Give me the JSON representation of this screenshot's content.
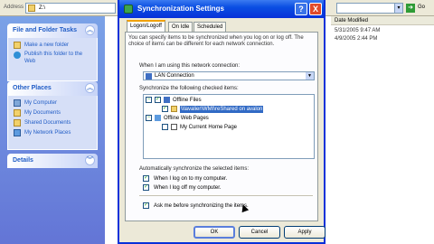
{
  "explorer": {
    "address_label": "Address",
    "address_value": "Z:\\",
    "go_label": "Go",
    "column_header": "Date Modified",
    "dates": [
      "5/31/2005 9:47 AM",
      "4/9/2005 2:44 PM"
    ],
    "panels": [
      {
        "title": "File and Folder Tasks",
        "items": [
          "Make a new folder",
          "Publish this folder to the Web"
        ]
      },
      {
        "title": "Other Places",
        "items": [
          "My Computer",
          "My Documents",
          "Shared Documents",
          "My Network Places"
        ]
      },
      {
        "title": "Details",
        "items": []
      }
    ]
  },
  "dialog": {
    "title": "Synchronization Settings",
    "help_label": "?",
    "close_label": "X",
    "tabs": [
      "Logon/Logoff",
      "On Idle",
      "Scheduled"
    ],
    "description": "You can specify items to be synchronized when you log on or log off. The choice of items can be different for each network connection.",
    "connection_label": "When I am using this network connection:",
    "connection_value": "LAN Connection",
    "sync_items_label": "Synchronize the following checked items:",
    "tree": {
      "offline_files": "Offline Files",
      "offline_files_child": "\\\\lavalier\\WMI\\reShared on avalon",
      "offline_web_pages": "Offline Web Pages",
      "web_child": "My Current Home Page"
    },
    "auto_label": "Automatically synchronize the selected items:",
    "checks": [
      {
        "label": "When I log on to my computer.",
        "checked": true
      },
      {
        "label": "When I log off my computer.",
        "checked": true
      },
      {
        "label": "Ask me before synchronizing the items.",
        "checked": true
      }
    ],
    "buttons": {
      "ok": "OK",
      "cancel": "Cancel",
      "apply": "Apply"
    }
  }
}
